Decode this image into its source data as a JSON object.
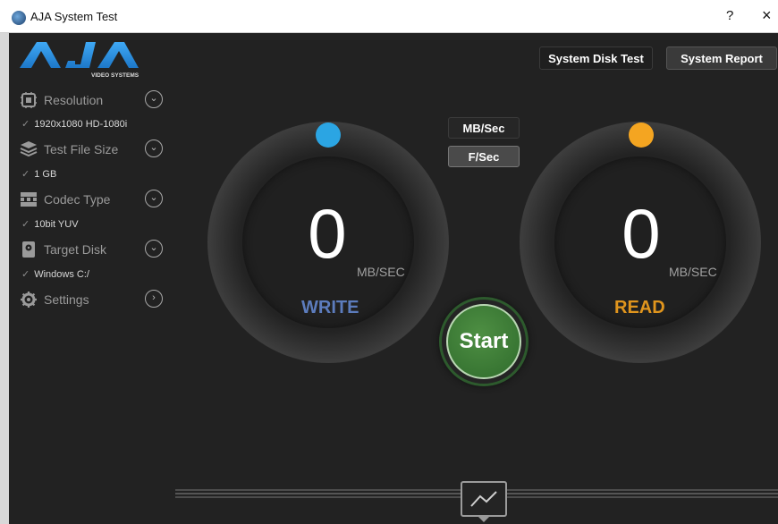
{
  "window": {
    "title": "AJA System Test",
    "help": "?",
    "close": "×"
  },
  "logo": {
    "brand": "AJA",
    "tagline": "VIDEO SYSTEMS"
  },
  "sidebar": {
    "items": [
      {
        "label": "Resolution",
        "value": "1920x1080 HD-1080i",
        "icon": "resolution-icon",
        "chevron": "chevron-down-icon"
      },
      {
        "label": "Test File Size",
        "value": "1 GB",
        "icon": "stack-icon",
        "chevron": "chevron-down-icon"
      },
      {
        "label": "Codec Type",
        "value": "10bit YUV",
        "icon": "grid-icon",
        "chevron": "chevron-down-icon"
      },
      {
        "label": "Target Disk",
        "value": "Windows C:/",
        "icon": "disk-icon",
        "chevron": "chevron-down-icon"
      },
      {
        "label": "Settings",
        "value": "",
        "icon": "gear-icon",
        "chevron": "chevron-right-icon"
      }
    ],
    "check": "✓"
  },
  "toolbar": {
    "system_disk_test": "System Disk Test",
    "system_report": "System Report"
  },
  "units_toggle": {
    "mb_sec": "MB/Sec",
    "f_sec": "F/Sec"
  },
  "write": {
    "value": "0",
    "unit": "MB/SEC",
    "label": "WRITE",
    "color": "#5c7cbd",
    "dot_color": "#2ba5e3"
  },
  "read": {
    "value": "0",
    "unit": "MB/SEC",
    "label": "READ",
    "color": "#e0951d",
    "dot_color": "#f4a521"
  },
  "start": {
    "label": "Start"
  }
}
